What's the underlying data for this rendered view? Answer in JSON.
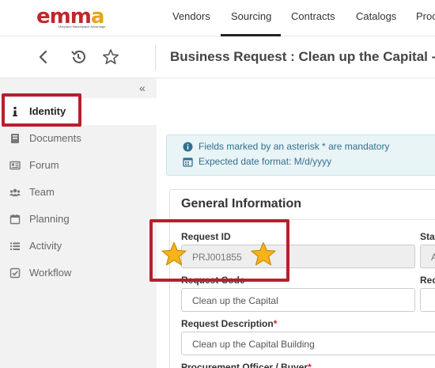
{
  "brand": {
    "logo_letters": [
      "e",
      "mm",
      "a"
    ],
    "logo_tagline": "Maryland Marketplace Advantage",
    "colors": {
      "red": "#c0272d",
      "gold": "#e8a417",
      "alert_blue": "#31708f",
      "highlight": "#b5202e"
    }
  },
  "topnav": {
    "tabs": [
      {
        "label": "Vendors",
        "active": false
      },
      {
        "label": "Sourcing",
        "active": true
      },
      {
        "label": "Contracts",
        "active": false
      },
      {
        "label": "Catalogs",
        "active": false
      },
      {
        "label": "Proc",
        "active": false
      }
    ]
  },
  "toolbar": {
    "icons": [
      "back-arrow-icon",
      "history-icon",
      "star-icon"
    ],
    "title": "Business Request : Clean up the Capital -"
  },
  "sidebar": {
    "collapse_glyph": "«",
    "items": [
      {
        "label": "Identity",
        "icon": "info-icon",
        "active": true
      },
      {
        "label": "Documents",
        "icon": "book-icon",
        "active": false
      },
      {
        "label": "Forum",
        "icon": "newspaper-icon",
        "active": false
      },
      {
        "label": "Team",
        "icon": "users-icon",
        "active": false
      },
      {
        "label": "Planning",
        "icon": "calendar-icon",
        "active": false
      },
      {
        "label": "Activity",
        "icon": "list-icon",
        "active": false
      },
      {
        "label": "Workflow",
        "icon": "checkbox-icon",
        "active": false
      }
    ]
  },
  "notice": {
    "mandatory": "Fields marked by an asterisk * are mandatory",
    "date_format": "Expected date format: M/d/yyyy"
  },
  "general": {
    "title": "General Information",
    "request_id_label": "Request ID",
    "request_id_value": "PRJ001855",
    "status_label": "Stat",
    "status_value": "A",
    "request_code_label": "Request Code",
    "request_code_value": "Clean up the Capital",
    "right_label_2": "Rec",
    "description_label": "Request Description",
    "description_value": "Clean up the Capital Building",
    "officer_label": "Procurement Officer / Buyer",
    "required_mark": "*"
  }
}
